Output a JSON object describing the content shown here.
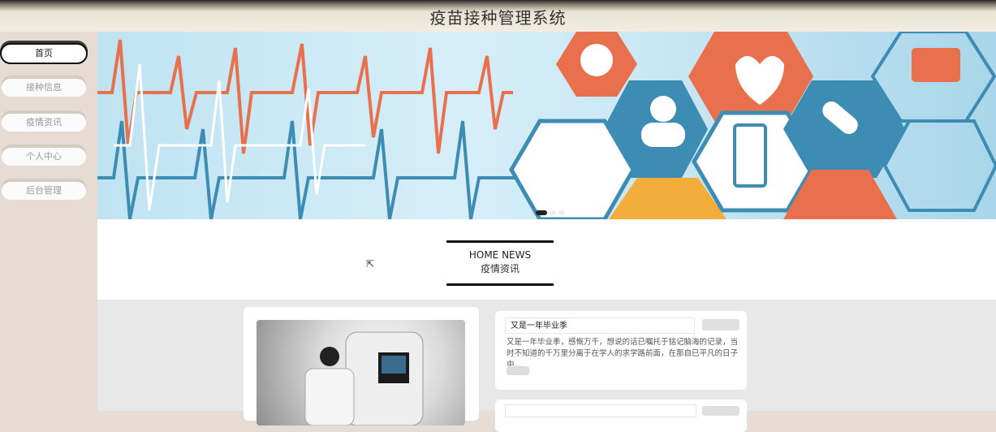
{
  "header": {
    "title": "疫苗接种管理系统"
  },
  "sidebar": {
    "items": [
      {
        "label": "首页",
        "active": true
      },
      {
        "label": "接种信息"
      },
      {
        "label": "疫情资讯"
      },
      {
        "label": "个人中心"
      },
      {
        "label": "后台管理"
      }
    ]
  },
  "banner": {
    "slides": 3,
    "current": 1
  },
  "news_section": {
    "title_en": "HOME NEWS",
    "title_cn": "疫情资讯"
  },
  "news": [
    {
      "title": "又是一年毕业季",
      "summary": "又是一年毕业季，感慨万千，想说的话已嘱托于铭记脑海的记录，当时不知道的千万里分离于在学人的求学路前面，在那自已平凡的日子中…"
    }
  ],
  "colors": {
    "sidebar_bg": "#e6dcd3",
    "content_gray": "#e8e8e8",
    "accent": "#111111"
  }
}
